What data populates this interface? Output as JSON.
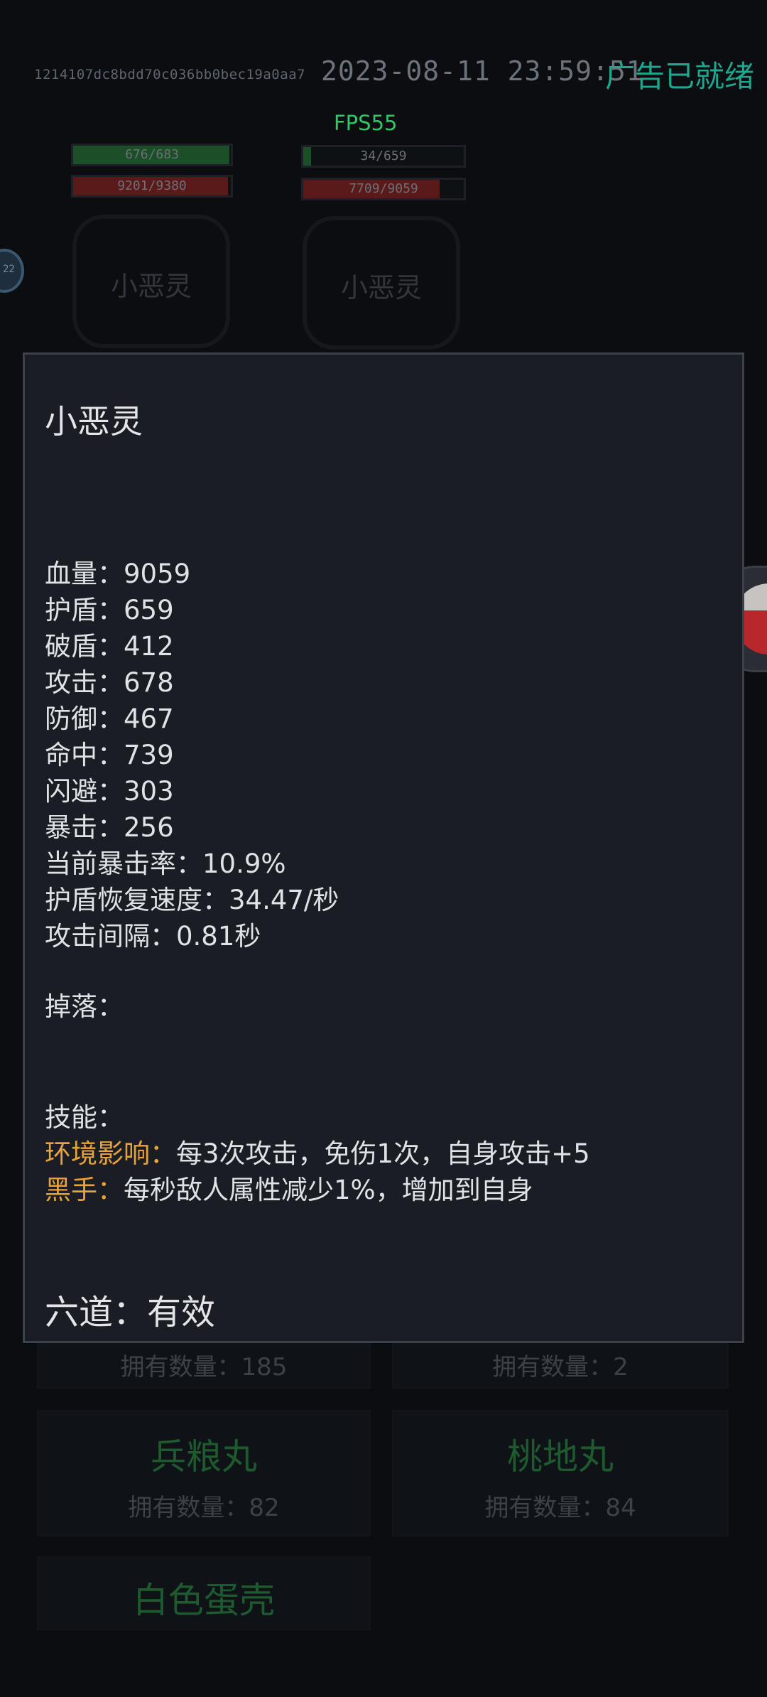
{
  "header": {
    "device_id": "1214107dc8bdd70c036bb0bec19a0aa7",
    "datetime": "2023-08-11 23:59:51",
    "ad_status": "广告已就绪",
    "fps": "FPS55"
  },
  "enemies": [
    {
      "name": "小恶灵",
      "shield_text": "676/683",
      "shield_fraction": 0.99,
      "hp_text": "9201/9380",
      "hp_fraction": 0.98
    },
    {
      "name": "小恶灵",
      "shield_text": "34/659",
      "shield_fraction": 0.05,
      "hp_text": "7709/9059",
      "hp_fraction": 0.85
    }
  ],
  "side_badge": "22",
  "modal": {
    "title": "小恶灵",
    "stats": [
      {
        "label": "血量：",
        "value": "9059"
      },
      {
        "label": "护盾：",
        "value": "659"
      },
      {
        "label": "破盾：",
        "value": "412"
      },
      {
        "label": "攻击：",
        "value": "678"
      },
      {
        "label": "防御：",
        "value": "467"
      },
      {
        "label": "命中：",
        "value": "739"
      },
      {
        "label": "闪避：",
        "value": "303"
      },
      {
        "label": "暴击：",
        "value": "256"
      },
      {
        "label": "当前暴击率：",
        "value": "10.9%"
      },
      {
        "label": "护盾恢复速度：",
        "value": "34.47/秒"
      },
      {
        "label": "攻击间隔：",
        "value": "0.81秒"
      }
    ],
    "drop_label": "掉落：",
    "skills_label": "技能：",
    "skills": [
      {
        "name": "环境影响：",
        "desc": "每3次攻击，免伤1次，自身攻击+5"
      },
      {
        "name": "黑手：",
        "desc": "每秒敌人属性减少1%，增加到自身"
      }
    ],
    "six_paths": "六道：有效"
  },
  "inventory": {
    "count_label": "拥有数量：",
    "items": [
      {
        "name": "",
        "count": "185"
      },
      {
        "name": "",
        "count": "2"
      },
      {
        "name": "兵粮丸",
        "count": "82"
      },
      {
        "name": "桃地丸",
        "count": "84"
      },
      {
        "name": "白色蛋壳",
        "count": ""
      }
    ]
  },
  "colors": {
    "ad_status": "#1fa68e",
    "fps": "#2ec866",
    "skill_name": "#e8a23a",
    "item_name": "#1d5a2e"
  }
}
